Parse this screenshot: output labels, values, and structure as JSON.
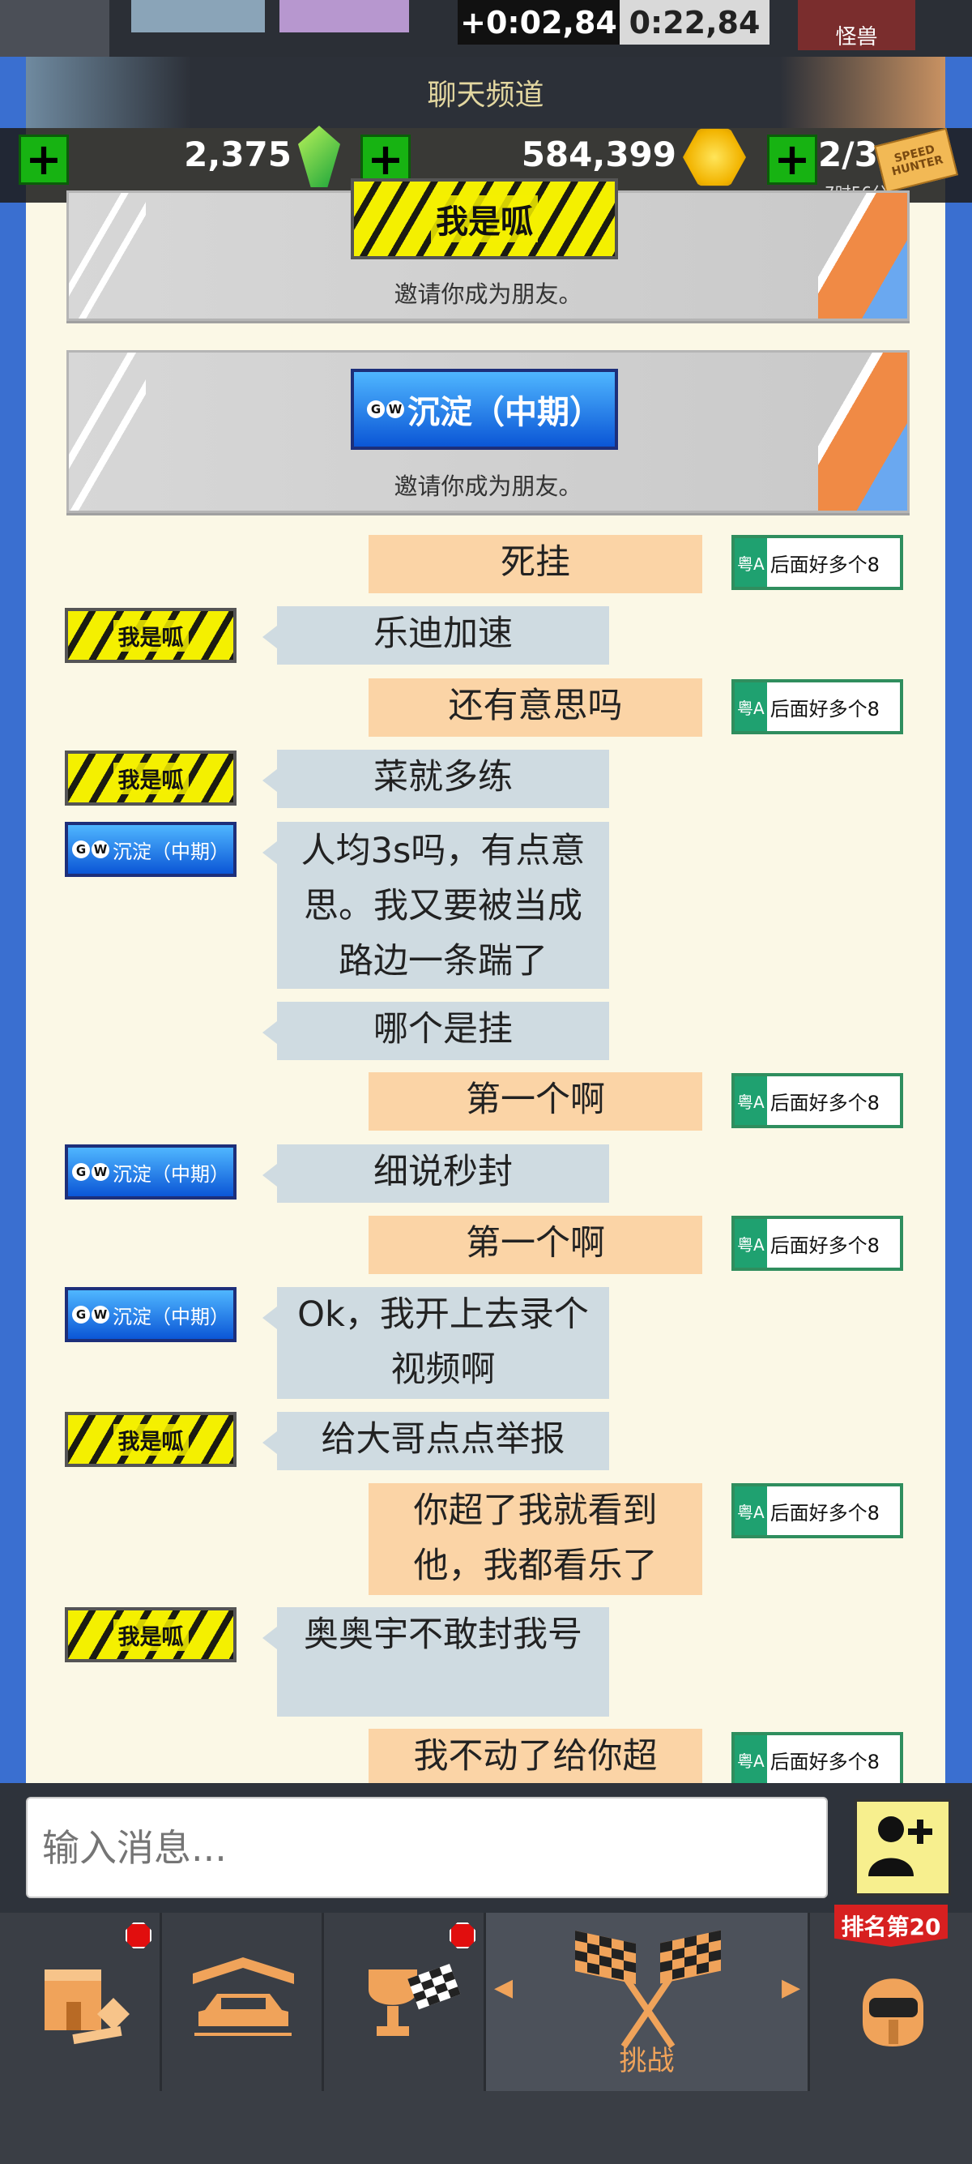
{
  "race_header": {
    "time_delta": "+0:02,84",
    "time_total": "0:22,84",
    "car_label": "怪兽"
  },
  "channel": {
    "title": "聊天频道"
  },
  "currency": {
    "gems": "2,375",
    "coins": "584,399",
    "tickets": "2/3",
    "ticket_timer": "7时56分",
    "ticket_text": "SPEED HUNTER"
  },
  "invites": [
    {
      "plate": "我是呱",
      "plate_style": "yellow",
      "text": "邀请你成为朋友。"
    },
    {
      "plate": "沉淀（中期）",
      "plate_style": "blue",
      "text": "邀请你成为朋友。"
    }
  ],
  "plates": {
    "me": {
      "prefix": "粤A",
      "text": "后面好多个8"
    },
    "wo_shi_gua": "我是呱",
    "chen_dian": "沉淀（中期）",
    "gw_g": "G",
    "gw_w": "W"
  },
  "messages": [
    {
      "side": "right",
      "text": "死挂"
    },
    {
      "side": "left",
      "sender": "wo_shi_gua",
      "text": "乐迪加速"
    },
    {
      "side": "right",
      "text": "还有意思吗"
    },
    {
      "side": "left",
      "sender": "wo_shi_gua",
      "text": "菜就多练"
    },
    {
      "side": "left",
      "sender": "chen_dian",
      "text": "人均3s吗，有点意思。我又要被当成路边一条踹了"
    },
    {
      "side": "left",
      "sender": "chen_dian",
      "text": "哪个是挂"
    },
    {
      "side": "right",
      "text": "第一个啊"
    },
    {
      "side": "left",
      "sender": "chen_dian",
      "text": "细说秒封"
    },
    {
      "side": "right",
      "text": "第一个啊"
    },
    {
      "side": "left",
      "sender": "chen_dian",
      "text": "Ok，我开上去录个视频啊"
    },
    {
      "side": "left",
      "sender": "wo_shi_gua",
      "text": "给大哥点点举报"
    },
    {
      "side": "right",
      "text": "你超了我就看到他，我都看乐了"
    },
    {
      "side": "left",
      "sender": "wo_shi_gua",
      "text": "奥奥宇不敢封我号"
    },
    {
      "side": "right",
      "text": "我不动了给你超"
    }
  ],
  "input": {
    "placeholder": "输入消息..."
  },
  "nav": {
    "items": [
      {
        "icon": "shop-icon",
        "badge": true
      },
      {
        "icon": "garage-icon",
        "badge": false
      },
      {
        "icon": "trophy-icon",
        "badge": true
      },
      {
        "icon": "challenge-flags-icon",
        "label": "挑战",
        "active": true
      },
      {
        "icon": "helmet-icon",
        "badge_text": "排名第20"
      }
    ]
  },
  "colors": {
    "accent_orange": "#f0a35a",
    "plus_green": "#17b312",
    "self_bubble": "#fbd4a6",
    "other_bubble": "#cfdbe1"
  }
}
